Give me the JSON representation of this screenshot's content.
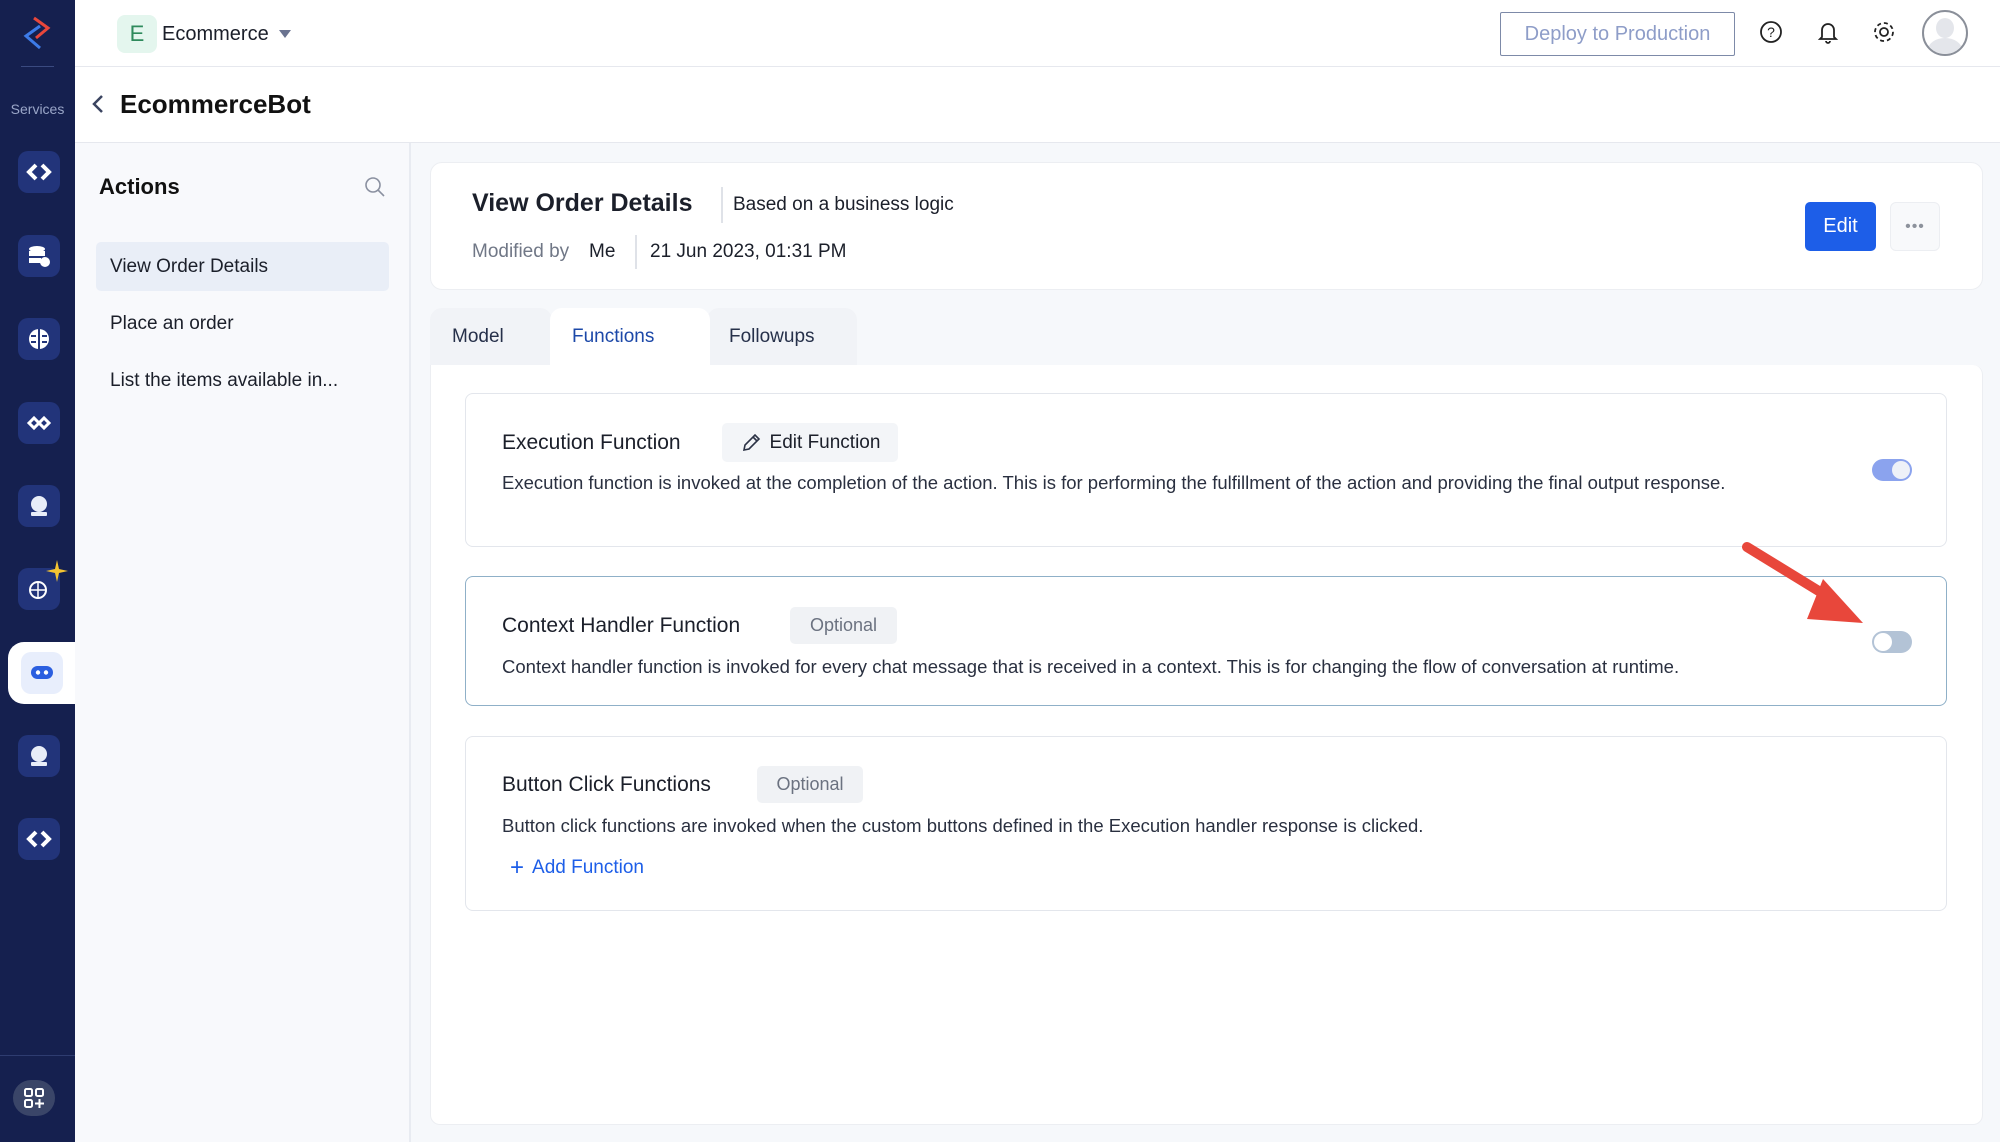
{
  "nav": {
    "services_label": "Services",
    "items": [
      "api-icon",
      "database-cloud-icon",
      "brain-icon",
      "integration-icon",
      "crystal-ball-icon",
      "ai-globe-icon",
      "chatbot-icon",
      "crystal-ball-icon",
      "api-icon"
    ],
    "active_index": 6
  },
  "topbar": {
    "workspace_initial": "E",
    "workspace_name": "Ecommerce",
    "deploy_label": "Deploy to Production"
  },
  "breadcrumb": {
    "title": "EcommerceBot"
  },
  "actions": {
    "heading": "Actions",
    "items": [
      {
        "label": "View Order Details",
        "selected": true
      },
      {
        "label": "Place an order",
        "selected": false
      },
      {
        "label": "List the items available in...",
        "selected": false
      }
    ]
  },
  "detail": {
    "title": "View Order Details",
    "type": "Based on a business logic",
    "modified_prefix": "Modified by",
    "modified_by": "Me",
    "modified_at": "21 Jun 2023, 01:31 PM",
    "edit_label": "Edit",
    "more_label": "•••"
  },
  "tabs": [
    {
      "label": "Model",
      "active": false
    },
    {
      "label": "Functions",
      "active": true
    },
    {
      "label": "Followups",
      "active": false
    }
  ],
  "functions": {
    "execution": {
      "title": "Execution Function",
      "edit_label": "Edit Function",
      "description": "Execution function is invoked at the completion of the action. This is for performing the fulfillment of the action and providing the final output response.",
      "enabled": true
    },
    "context": {
      "title": "Context Handler Function",
      "badge": "Optional",
      "description": "Context handler function is invoked for every chat message that is received in a context. This is for changing the flow of conversation at runtime.",
      "enabled": false
    },
    "button_click": {
      "title": "Button Click Functions",
      "badge": "Optional",
      "description": "Button click functions are invoked when the custom buttons defined in the Execution handler response is clicked.",
      "add_label": "Add Function"
    }
  },
  "colors": {
    "nav_bg": "#15204f",
    "primary": "#1d5ee8",
    "toggle_on": "#8ba3ee",
    "toggle_off": "#b3c3d6",
    "arrow": "#e8473b"
  }
}
